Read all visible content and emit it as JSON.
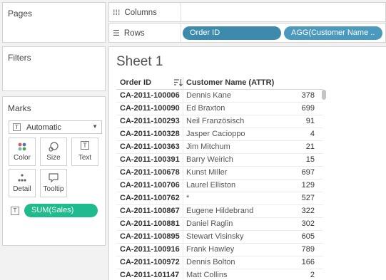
{
  "cards": {
    "pages_title": "Pages",
    "filters_title": "Filters",
    "marks_title": "Marks"
  },
  "marks": {
    "type_label": "Automatic",
    "buttons": [
      {
        "label": "Color",
        "icon": "color-dots-icon"
      },
      {
        "label": "Size",
        "icon": "size-icon"
      },
      {
        "label": "Text",
        "icon": "text-icon"
      },
      {
        "label": "Detail",
        "icon": "detail-icon"
      },
      {
        "label": "Tooltip",
        "icon": "tooltip-icon"
      }
    ],
    "pill_label": "SUM(Sales)"
  },
  "shelves": {
    "columns_label": "Columns",
    "rows_label": "Rows",
    "row_pills": [
      "Order ID",
      "AGG(Customer Name .."
    ]
  },
  "sheet": {
    "title": "Sheet 1",
    "col_order_id": "Order ID",
    "col_customer": "Customer Name (ATTR)",
    "rows": [
      {
        "order_id": "CA-2011-100006",
        "customer": "Dennis Kane",
        "value": "378"
      },
      {
        "order_id": "CA-2011-100090",
        "customer": "Ed Braxton",
        "value": "699"
      },
      {
        "order_id": "CA-2011-100293",
        "customer": "Neil Französisch",
        "value": "91"
      },
      {
        "order_id": "CA-2011-100328",
        "customer": "Jasper Cacioppo",
        "value": "4"
      },
      {
        "order_id": "CA-2011-100363",
        "customer": "Jim Mitchum",
        "value": "21"
      },
      {
        "order_id": "CA-2011-100391",
        "customer": "Barry Weirich",
        "value": "15"
      },
      {
        "order_id": "CA-2011-100678",
        "customer": "Kunst Miller",
        "value": "697"
      },
      {
        "order_id": "CA-2011-100706",
        "customer": "Laurel Elliston",
        "value": "129"
      },
      {
        "order_id": "CA-2011-100762",
        "customer": "*",
        "value": "527"
      },
      {
        "order_id": "CA-2011-100867",
        "customer": "Eugene Hildebrand",
        "value": "322"
      },
      {
        "order_id": "CA-2011-100881",
        "customer": "Daniel Raglin",
        "value": "302"
      },
      {
        "order_id": "CA-2011-100895",
        "customer": "Stewart Visinsky",
        "value": "605"
      },
      {
        "order_id": "CA-2011-100916",
        "customer": "Frank Hawley",
        "value": "789"
      },
      {
        "order_id": "CA-2011-100972",
        "customer": "Dennis Bolton",
        "value": "166"
      },
      {
        "order_id": "CA-2011-101147",
        "customer": "Matt Collins",
        "value": "2"
      }
    ]
  }
}
